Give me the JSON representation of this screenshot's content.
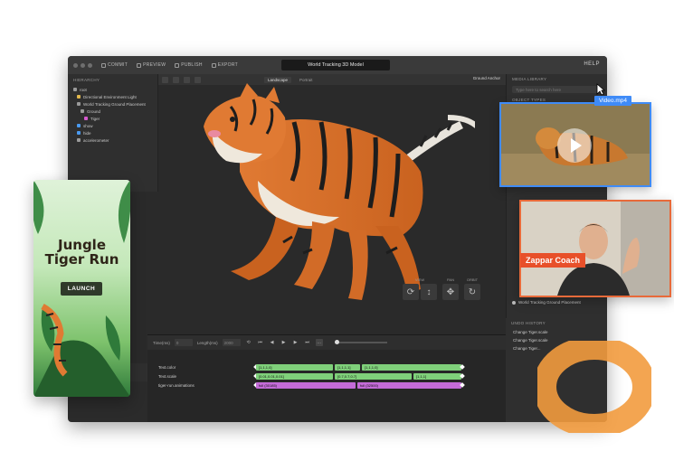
{
  "editor": {
    "toolbar": {
      "commit": "COMMIT",
      "preview": "PREVIEW",
      "publish": "PUBLISH",
      "export": "EXPORT"
    },
    "project_title": "World Tracking 3D Model",
    "help": "HELP",
    "hierarchy": {
      "header": "HIERARCHY",
      "items": [
        {
          "label": "root",
          "color": "#9a9a9a"
        },
        {
          "label": "Directional Environment Light",
          "color": "#e2b84c"
        },
        {
          "label": "World Tracking Ground Placement",
          "color": "#9a9a9a"
        },
        {
          "label": "Ground",
          "color": "#9a9a9a"
        },
        {
          "label": "Tiger",
          "color": "#d85bd0"
        },
        {
          "label": "show",
          "color": "#4a9af0"
        },
        {
          "label": "hide",
          "color": "#4a9af0"
        },
        {
          "label": "accelerometer",
          "color": "#9a9a9a"
        }
      ]
    },
    "viewport": {
      "tabs": [
        "Landscape",
        "Portrait"
      ],
      "anchor": "Ground Anchor",
      "gizmo": {
        "groups": [
          "VIEW",
          "PAN",
          "ORBIT"
        ]
      }
    },
    "media_library": {
      "header": "MEDIA LIBRARY",
      "search_placeholder": "Type here to search here",
      "section": "OBJECT TYPES"
    },
    "undo_history": {
      "header": "UNDO HISTORY",
      "items": [
        "Change Tiger.scale",
        "Change Tiger.scale",
        "Change Tiger..."
      ]
    },
    "right_list": {
      "item": "World Tracking Ground Placement"
    },
    "timeline": {
      "time_label": "Time(ms)",
      "time_value": "0",
      "length_label": "Length(ms)",
      "length_value": "2000",
      "rows": [
        {
          "label": "Text.color",
          "bars": [
            {
              "text": "[1,1,1,0]",
              "color": "green"
            },
            {
              "text": "[1,1,1,1]",
              "color": "green"
            },
            {
              "text": "[1,1,1,0]",
              "color": "green"
            }
          ]
        },
        {
          "label": "Text.scale",
          "bars": [
            {
              "text": "[0.01,0.01,0.01]",
              "color": "green"
            },
            {
              "text": "[0.7,0.7,0.7]",
              "color": "green"
            },
            {
              "text": "[1,1,1]",
              "color": "green"
            }
          ]
        },
        {
          "label": "tiger-run.animations",
          "bars": [
            {
              "text": "full (30185)",
              "color": "purple"
            },
            {
              "text": "full (32500)",
              "color": "purple"
            }
          ]
        }
      ]
    }
  },
  "phone": {
    "title_line1": "Jungle",
    "title_line2": "Tiger Run",
    "launch": "LAUNCH"
  },
  "video_card": {
    "tag": "Video.mp4"
  },
  "coach_card": {
    "tag": "Zappar Coach"
  },
  "colors": {
    "accent_blue": "#3f8bf7",
    "accent_orange": "#e8502a",
    "timeline_green": "#7fd07a",
    "timeline_purple": "#c46bd8"
  }
}
